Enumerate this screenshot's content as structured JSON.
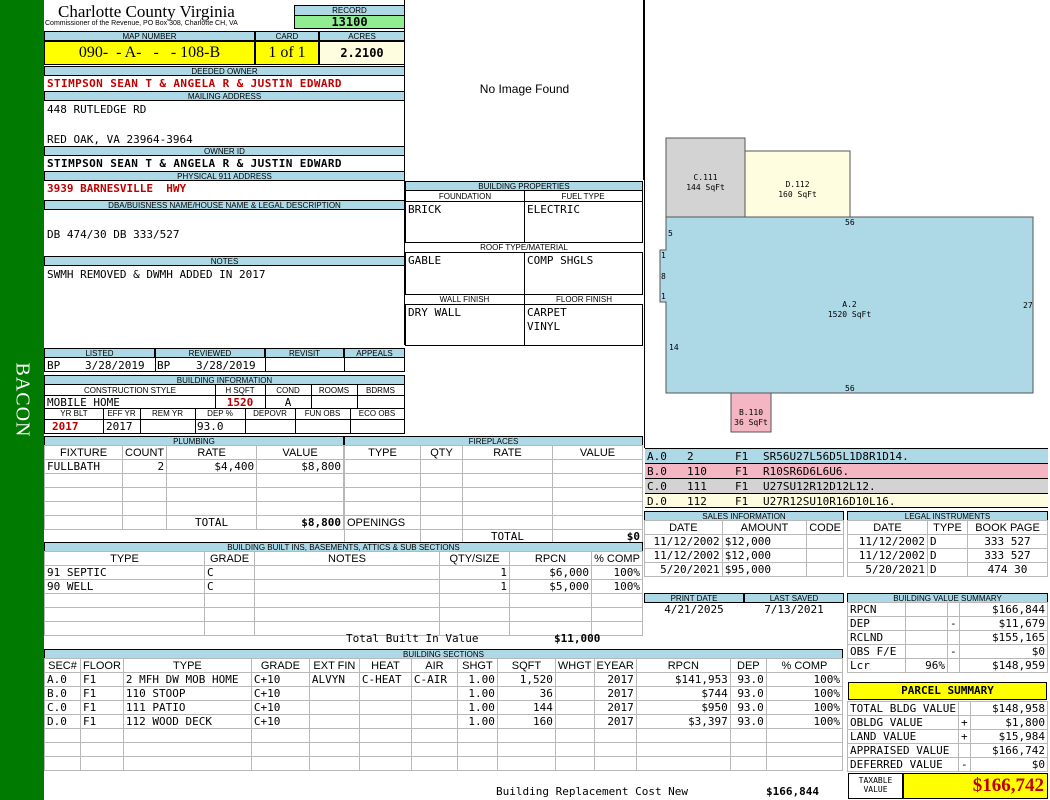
{
  "sidebar": {
    "text": "BACON",
    "color": "#007a00"
  },
  "header": {
    "county": "Charlotte County Virginia",
    "office": "Commissioner of the Revenue, PO Box 308, Charlotte CH, VA",
    "record_label": "RECORD",
    "record": "13100"
  },
  "map": {
    "label": "MAP NUMBER",
    "value": "090-  - A-   -   - 108-B",
    "card_label": "CARD",
    "card": "1 of 1",
    "acres_label": "ACRES",
    "acres": "2.2100"
  },
  "owner": {
    "deeded_label": "DEEDED OWNER",
    "deeded": "STIMPSON SEAN T & ANGELA R & JUSTIN EDWARD",
    "mailing_label": "MAILING ADDRESS",
    "mailing_1": "448 RUTLEDGE RD",
    "mailing_2": "RED OAK, VA 23964-3964",
    "id_label": "OWNER ID",
    "id": "STIMPSON SEAN T & ANGELA R & JUSTIN EDWARD",
    "physical_label": "PHYSICAL 911 ADDRESS",
    "physical": "3939 BARNESVILLE  HWY"
  },
  "legal": {
    "label": "DBA/BUISNESS NAME/HOUSE NAME & LEGAL DESCRIPTION",
    "text": "DB 474/30 DB 333/527"
  },
  "notes": {
    "label": "NOTES",
    "text": "SWMH REMOVED & DWMH ADDED IN 2017"
  },
  "image": {
    "text": "No Image Found"
  },
  "props": {
    "label": "BUILDING PROPERTIES",
    "foundation_label": "FOUNDATION",
    "foundation": "BRICK",
    "fuel_label": "FUEL TYPE",
    "fuel": "ELECTRIC",
    "roof_label": "ROOF TYPE/MATERIAL",
    "roof_type": "GABLE",
    "roof_material": "COMP SHGLS",
    "wall_label": "WALL FINISH",
    "wall": "DRY WALL",
    "floor_label": "FLOOR FINISH",
    "floor_1": "CARPET",
    "floor_2": "VINYL"
  },
  "listing": {
    "listed_label": "LISTED",
    "listed_by": "BP",
    "listed": "3/28/2019",
    "reviewed_label": "REVIEWED",
    "reviewed_by": "BP",
    "reviewed": "3/28/2019",
    "revisit_label": "REVISIT",
    "appeals_label": "APPEALS"
  },
  "building_info": {
    "label": "BUILDING INFORMATION",
    "style_label": "CONSTRUCTION STYLE",
    "style": "MOBILE HOME",
    "hsqft_label": "H SQFT",
    "hsqft": "1520",
    "cond_label": "COND",
    "cond": "A",
    "rooms_label": "ROOMS",
    "bdrms_label": "BDRMS",
    "yrblt_label": "YR BLT",
    "yrblt": "2017",
    "effyr_label": "EFF YR",
    "effyr": "2017",
    "remyr_label": "REM YR",
    "dep_label": "DEP %",
    "dep": "93.0",
    "depovr_label": "DEPOVR",
    "funobs_label": "FUN OBS",
    "ecoobs_label": "ECO OBS"
  },
  "plumbing": {
    "label": "PLUMBING",
    "headers": [
      "FIXTURE",
      "COUNT",
      "RATE",
      "VALUE"
    ],
    "rows": [
      [
        "FULLBATH",
        "2",
        "$4,400",
        "$8,800"
      ]
    ],
    "total_label": "TOTAL",
    "total": "$8,800"
  },
  "fireplaces": {
    "label": "FIREPLACES",
    "headers": [
      "TYPE",
      "QTY",
      "RATE",
      "VALUE"
    ],
    "openings_label": "OPENINGS",
    "total_label": "TOTAL",
    "total": "$0"
  },
  "builtins": {
    "label": "BUILDING BUILT INS, BASEMENTS, ATTICS & SUB SECTIONS",
    "headers": [
      "TYPE",
      "GRADE",
      "NOTES",
      "QTY/SIZE",
      "RPCN",
      "% COMP"
    ],
    "rows": [
      [
        "91 SEPTIC",
        "C",
        "",
        "1",
        "$6,000",
        "100%"
      ],
      [
        "90 WELL",
        "C",
        "",
        "1",
        "$5,000",
        "100%"
      ]
    ],
    "total_label": "Total Built In Value",
    "total": "$11,000"
  },
  "sections": {
    "label": "BUILDING SECTIONS",
    "headers": [
      "SEC#",
      "FLOOR",
      "TYPE",
      "GRADE",
      "EXT FIN",
      "HEAT",
      "AIR",
      "SHGT",
      "SQFT",
      "WHGT",
      "EYEAR",
      "RPCN",
      "DEP",
      "% COMP"
    ],
    "rows": [
      [
        "A.0",
        "F1",
        "2 MFH DW MOB HOME",
        "C+10",
        "ALVYN",
        "C-HEAT",
        "C-AIR",
        "1.00",
        "1,520",
        "",
        "2017",
        "$141,953",
        "93.0",
        "100%"
      ],
      [
        "B.0",
        "F1",
        "110 STOOP",
        "C+10",
        "",
        "",
        "",
        "1.00",
        "36",
        "",
        "2017",
        "$744",
        "93.0",
        "100%"
      ],
      [
        "C.0",
        "F1",
        "111 PATIO",
        "C+10",
        "",
        "",
        "",
        "1.00",
        "144",
        "",
        "2017",
        "$950",
        "93.0",
        "100%"
      ],
      [
        "D.0",
        "F1",
        "112 WOOD DECK",
        "C+10",
        "",
        "",
        "",
        "1.00",
        "160",
        "",
        "2017",
        "$3,397",
        "93.0",
        "100%"
      ]
    ],
    "brcn_label": "Building Replacement Cost New",
    "brcn": "$166,844"
  },
  "sketch": {
    "c": {
      "name": "C.111",
      "area": "144 SqFt",
      "color": "#d3d3d3"
    },
    "d": {
      "name": "D.112",
      "area": "160 SqFt",
      "color": "#fffde0"
    },
    "a": {
      "name": "A.2",
      "area": "1520 SqFt",
      "color": "#add8e6"
    },
    "b": {
      "name": "B.110",
      "area": "36 SqFt",
      "color": "#f4b6c2"
    },
    "dims": {
      "top": "56",
      "bottom": "56",
      "right": "27",
      "left": "14",
      "l1": "5",
      "l2": "1",
      "l3": "8",
      "l4": "1"
    }
  },
  "vectors": [
    {
      "sec": "A.0",
      "num": "2",
      "floor": "F1",
      "path": "SR56U27L56D5L1D8R1D14.",
      "color": "#add8e6"
    },
    {
      "sec": "B.0",
      "num": "110",
      "floor": "F1",
      "path": "R10SR6D6L6U6.",
      "color": "#f4b6c2"
    },
    {
      "sec": "C.0",
      "num": "111",
      "floor": "F1",
      "path": "U27SU12R12D12L12.",
      "color": "#d3d3d3"
    },
    {
      "sec": "D.0",
      "num": "112",
      "floor": "F1",
      "path": "U27R12SU10R16D10L16.",
      "color": "#fffde0"
    }
  ],
  "sales": {
    "label": "SALES INFORMATION",
    "headers": [
      "DATE",
      "AMOUNT",
      "CODE"
    ],
    "rows": [
      [
        "11/12/2002",
        "$12,000",
        ""
      ],
      [
        "11/12/2002",
        "$12,000",
        ""
      ],
      [
        "5/20/2021",
        "$95,000",
        ""
      ]
    ]
  },
  "legal_inst": {
    "label": "LEGAL INSTRUMENTS",
    "headers": [
      "DATE",
      "TYPE",
      "BOOK PAGE"
    ],
    "rows": [
      [
        "11/12/2002",
        "D",
        "333 527"
      ],
      [
        "11/12/2002",
        "D",
        "333 527"
      ],
      [
        "5/20/2021",
        "D",
        "474 30"
      ]
    ]
  },
  "dates": {
    "print_label": "PRINT DATE",
    "print": "4/21/2025",
    "saved_label": "LAST SAVED",
    "saved": "7/13/2021"
  },
  "bvs": {
    "label": "BUILDING VALUE SUMMARY",
    "rows": [
      {
        "label": "RPCN",
        "sign": "",
        "value": "$166,844"
      },
      {
        "label": "DEP",
        "sign": "-",
        "value": "$11,679"
      },
      {
        "label": "RCLND",
        "sign": "",
        "value": "$155,165"
      },
      {
        "label": "OBS F/E",
        "sign": "-",
        "value": "$0"
      },
      {
        "label": "Lcr",
        "pct": "96%",
        "sign": "",
        "value": "$148,959"
      }
    ]
  },
  "parcel": {
    "label": "PARCEL SUMMARY",
    "rows": [
      {
        "label": "TOTAL BLDG VALUE",
        "sign": "",
        "value": "$148,958"
      },
      {
        "label": "OBLDG VALUE",
        "sign": "+",
        "value": "$1,800"
      },
      {
        "label": "LAND VALUE",
        "sign": "+",
        "value": "$15,984"
      },
      {
        "label": "APPRAISED VALUE",
        "sign": "",
        "value": "$166,742"
      },
      {
        "label": "DEFERRED VALUE",
        "sign": "-",
        "value": "$0"
      }
    ],
    "taxable_label_1": "TAXABLE",
    "taxable_label_2": "VALUE",
    "taxable": "$166,742",
    "accent": "#ffff00"
  }
}
